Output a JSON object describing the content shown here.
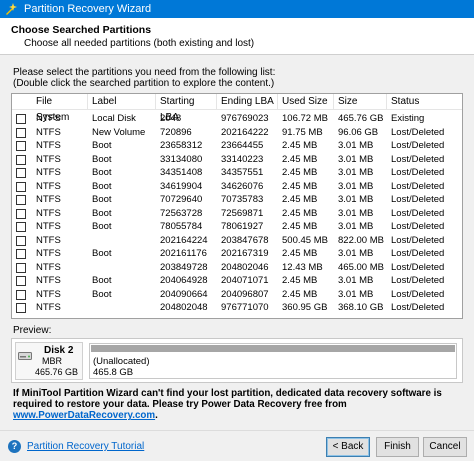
{
  "window": {
    "title": "Partition Recovery Wizard",
    "app_icon": "minitool-wizard-icon"
  },
  "header": {
    "title": "Choose Searched Partitions",
    "subtitle": "Choose all needed partitions (both existing and lost)"
  },
  "instructions": {
    "line1": "Please select the partitions you need from the following list:",
    "line2": "(Double click the searched partition to explore the content.)"
  },
  "table": {
    "columns": [
      "File System",
      "Label",
      "Starting LBA",
      "Ending LBA",
      "Used Size",
      "Size",
      "Status"
    ],
    "rows": [
      {
        "fs": "NTFS",
        "label": "Local Disk",
        "start": "2048",
        "end": "976769023",
        "used": "106.72 MB",
        "size": "465.76 GB",
        "status": "Existing"
      },
      {
        "fs": "NTFS",
        "label": "New Volume",
        "start": "720896",
        "end": "202164222",
        "used": "91.75 MB",
        "size": "96.06 GB",
        "status": "Lost/Deleted"
      },
      {
        "fs": "NTFS",
        "label": "Boot",
        "start": "23658312",
        "end": "23664455",
        "used": "2.45 MB",
        "size": "3.01 MB",
        "status": "Lost/Deleted"
      },
      {
        "fs": "NTFS",
        "label": "Boot",
        "start": "33134080",
        "end": "33140223",
        "used": "2.45 MB",
        "size": "3.01 MB",
        "status": "Lost/Deleted"
      },
      {
        "fs": "NTFS",
        "label": "Boot",
        "start": "34351408",
        "end": "34357551",
        "used": "2.45 MB",
        "size": "3.01 MB",
        "status": "Lost/Deleted"
      },
      {
        "fs": "NTFS",
        "label": "Boot",
        "start": "34619904",
        "end": "34626076",
        "used": "2.45 MB",
        "size": "3.01 MB",
        "status": "Lost/Deleted"
      },
      {
        "fs": "NTFS",
        "label": "Boot",
        "start": "70729640",
        "end": "70735783",
        "used": "2.45 MB",
        "size": "3.01 MB",
        "status": "Lost/Deleted"
      },
      {
        "fs": "NTFS",
        "label": "Boot",
        "start": "72563728",
        "end": "72569871",
        "used": "2.45 MB",
        "size": "3.01 MB",
        "status": "Lost/Deleted"
      },
      {
        "fs": "NTFS",
        "label": "Boot",
        "start": "78055784",
        "end": "78061927",
        "used": "2.45 MB",
        "size": "3.01 MB",
        "status": "Lost/Deleted"
      },
      {
        "fs": "NTFS",
        "label": "",
        "start": "202164224",
        "end": "203847678",
        "used": "500.45 MB",
        "size": "822.00 MB",
        "status": "Lost/Deleted"
      },
      {
        "fs": "NTFS",
        "label": "Boot",
        "start": "202161176",
        "end": "202167319",
        "used": "2.45 MB",
        "size": "3.01 MB",
        "status": "Lost/Deleted"
      },
      {
        "fs": "NTFS",
        "label": "",
        "start": "203849728",
        "end": "204802046",
        "used": "12.43 MB",
        "size": "465.00 MB",
        "status": "Lost/Deleted"
      },
      {
        "fs": "NTFS",
        "label": "Boot",
        "start": "204064928",
        "end": "204071071",
        "used": "2.45 MB",
        "size": "3.01 MB",
        "status": "Lost/Deleted"
      },
      {
        "fs": "NTFS",
        "label": "Boot",
        "start": "204090664",
        "end": "204096807",
        "used": "2.45 MB",
        "size": "3.01 MB",
        "status": "Lost/Deleted"
      },
      {
        "fs": "NTFS",
        "label": "",
        "start": "204802048",
        "end": "976771070",
        "used": "360.95 GB",
        "size": "368.10 GB",
        "status": "Lost/Deleted"
      }
    ]
  },
  "preview": {
    "label": "Preview:",
    "disk": {
      "name": "Disk 2",
      "type": "MBR",
      "size": "465.76 GB"
    },
    "partition": {
      "name": "(Unallocated)",
      "size": "465.8 GB"
    }
  },
  "notice": {
    "text": "If MiniTool Partition Wizard can't find your lost partition, dedicated data recovery software is required to restore your data. Please try Power Data Recovery free from ",
    "link": "www.PowerDataRecovery.com",
    "end": "."
  },
  "footer": {
    "tutorial_link": "Partition Recovery Tutorial",
    "back": "< Back",
    "finish": "Finish",
    "cancel": "Cancel"
  }
}
